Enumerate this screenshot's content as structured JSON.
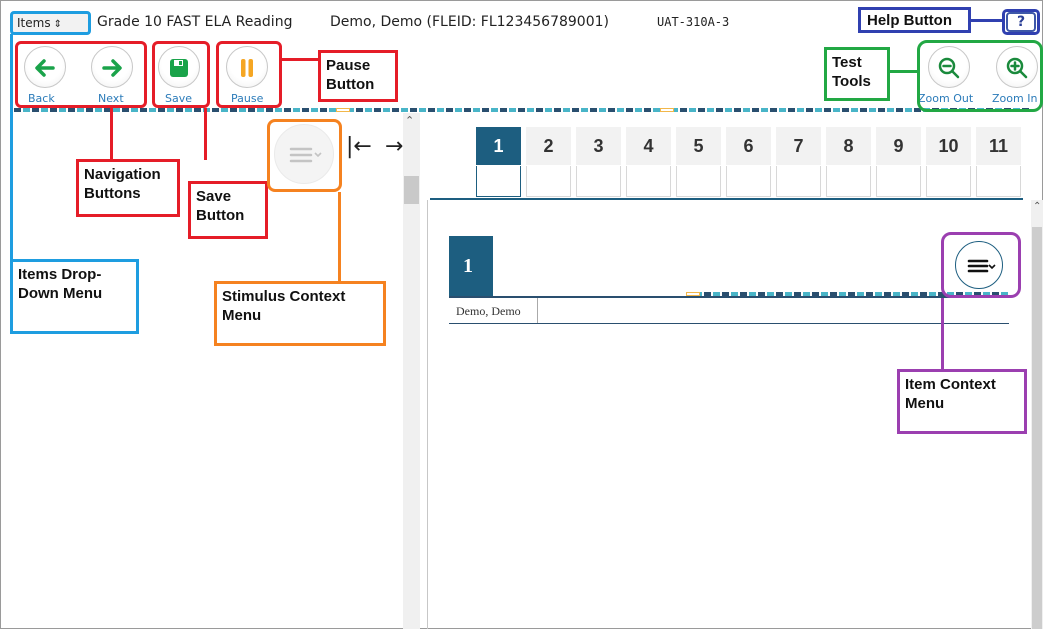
{
  "header": {
    "items_dropdown": "Items",
    "test_title": "Grade 10 FAST ELA Reading",
    "student": "Demo, Demo (FLEID: FL123456789001)",
    "session_id": "UAT-310A-3",
    "help_label": "?"
  },
  "toolbar": {
    "back_label": "Back",
    "next_label": "Next",
    "save_label": "Save",
    "pause_label": "Pause",
    "zoom_out_label": "Zoom Out",
    "zoom_in_label": "Zoom In"
  },
  "question_tabs": [
    "1",
    "2",
    "3",
    "4",
    "5",
    "6",
    "7",
    "8",
    "9",
    "10",
    "11"
  ],
  "active_tab": "1",
  "item": {
    "number": "1",
    "student_name": "Demo, Demo"
  },
  "annotations": {
    "help_button": "Help Button",
    "pause_button": "Pause Button",
    "test_tools": "Test Tools",
    "navigation_buttons": "Navigation Buttons",
    "save_button": "Save Button",
    "items_dropdown": "Items Drop-Down Menu",
    "stimulus_context": "Stimulus Context Menu",
    "item_context": "Item Context Menu"
  },
  "colors": {
    "nav_green": "#1aa34a",
    "save_green": "#1aa34a",
    "pause_orange": "#f5a623",
    "zoom_green": "#1a8a3c",
    "tab_active": "#1d5e80",
    "callout_red": "#e51d28",
    "callout_blue": "#1e9de0",
    "callout_navy": "#3040b0",
    "callout_green": "#22a844",
    "callout_orange": "#f58220",
    "callout_purple": "#9b3fb0"
  }
}
